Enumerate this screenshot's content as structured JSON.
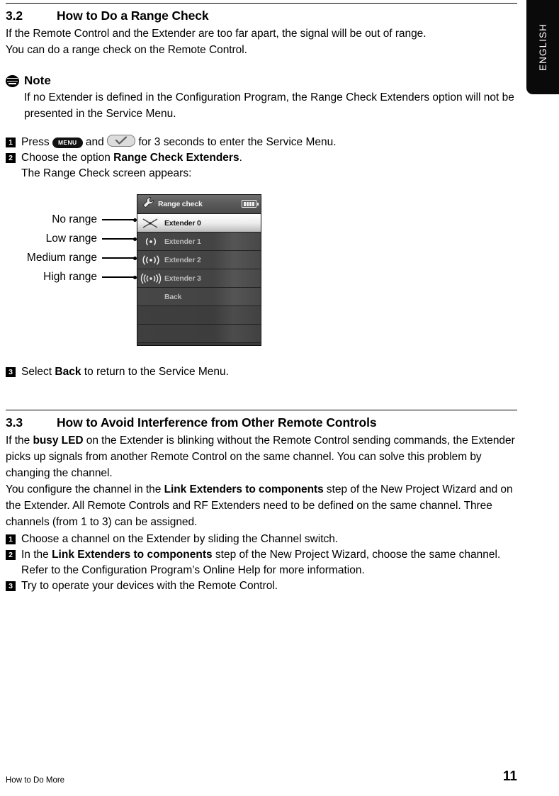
{
  "language_tab": {
    "label": "ENGLISH"
  },
  "section_32": {
    "number": "3.2",
    "title": "How to Do a Range Check",
    "body_line1": "If the Remote Control and the Extender are too far apart, the signal will be out of range.",
    "body_line2": "You can do a range check on the Remote Control."
  },
  "note": {
    "icon": "note-icon",
    "title": "Note",
    "body": "If no Extender is defined in the Configuration Program, the Range Check Extenders option will not be presented in the Service Menu."
  },
  "steps_32": [
    {
      "number": "1",
      "pre": "Press ",
      "key1": "MENU",
      "mid": " and ",
      "key2": "check-icon",
      "post": " for 3 seconds to enter the Service Menu."
    },
    {
      "number": "2",
      "pre": "Choose the option ",
      "bold": "Range Check Extenders",
      "post": ".",
      "continuation": "The Range Check screen appears:"
    }
  ],
  "step_3_after_figure": {
    "number": "3",
    "pre": "Select ",
    "bold": "Back",
    "post": " to return to the Service Menu."
  },
  "figure": {
    "callouts": [
      {
        "label": "No range"
      },
      {
        "label": "Low range"
      },
      {
        "label": "Medium range"
      },
      {
        "label": "High range"
      }
    ],
    "screen": {
      "header": {
        "icon": "wrench-icon",
        "title": "Range check",
        "battery": "battery-icon",
        "battery_bars": 4
      },
      "rows": [
        {
          "label": "Extender 0",
          "icon": "no-signal-icon",
          "selected": true
        },
        {
          "label": "Extender 1",
          "icon": "signal-low-icon",
          "selected": false
        },
        {
          "label": "Extender 2",
          "icon": "signal-medium-icon",
          "selected": false
        },
        {
          "label": "Extender 3",
          "icon": "signal-high-icon",
          "selected": false
        },
        {
          "label": "Back",
          "icon": "",
          "selected": false
        }
      ],
      "empty_rows": 2
    }
  },
  "section_33": {
    "number": "3.3",
    "title": "How to Avoid Interference from Other Remote Controls",
    "para1_a": "If the ",
    "para1_bold": "busy LED",
    "para1_b": " on the Extender is blinking without the Remote Control sending commands, the Extender picks up signals from another Remote Control on the same channel. You can solve this problem by changing the channel.",
    "para2_a": "You configure the channel in the ",
    "para2_bold": "Link Extenders to components",
    "para2_b": " step of the New Project Wizard and on the Extender. All Remote Controls and RF Extenders need to be defined on the same channel. Three channels (from 1 to 3) can be assigned."
  },
  "steps_33": [
    {
      "number": "1",
      "text": "Choose a channel on the Extender by sliding the Channel switch."
    },
    {
      "number": "2",
      "pre": "In the ",
      "bold": "Link Extenders to components",
      "post": " step of the New Project Wizard, choose the same channel.",
      "continuation": "Refer to the Configuration Program’s Online Help for more information."
    },
    {
      "number": "3",
      "text": "Try to operate your devices with the Remote Control."
    }
  ],
  "footer": {
    "left": "How to Do More",
    "page_number": "11"
  },
  "colors": {
    "page_bg": "#ffffff",
    "text": "#000000",
    "tab_bg": "#0a0a0a",
    "screen_bg": "#3a3a3a",
    "screen_header": "#5b5b5b",
    "row_selected": "#ededed",
    "row_label_dim": "#b9b9b9"
  }
}
